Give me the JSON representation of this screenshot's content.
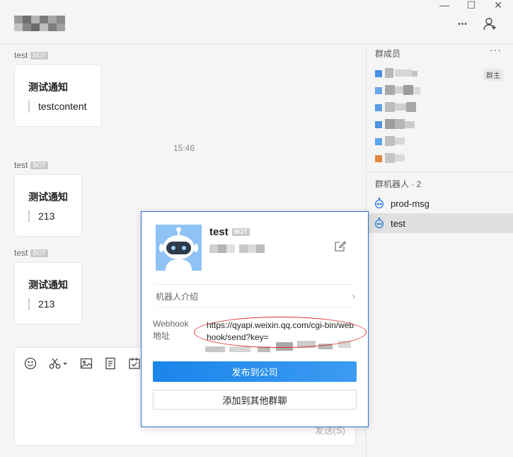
{
  "window": {
    "minimize_glyph": "—",
    "maximize_glyph": "☐",
    "close_glyph": "✕",
    "more_glyph": "•••",
    "add_member_icon": "add-user-icon"
  },
  "messages": [
    {
      "sender": "test",
      "badge": "BOT",
      "title": "测试通知",
      "content": "testcontent"
    },
    {
      "sender": "test",
      "badge": "BOT",
      "title": "测试通知",
      "content": "213"
    },
    {
      "sender": "test",
      "badge": "BOT",
      "title": "测试通知",
      "content": "213"
    }
  ],
  "timestamp": "15:46",
  "composer": {
    "tools": [
      "emoji-icon",
      "scissors-icon",
      "image-icon",
      "document-icon",
      "checklist-icon"
    ],
    "send_label": "发送(S)"
  },
  "side": {
    "members_header": "群成员",
    "more": "···",
    "owner_tag": "群主",
    "robots_header": "群机器人 · 2",
    "robots": [
      {
        "name": "prod-msg",
        "active": false
      },
      {
        "name": "test",
        "active": true
      }
    ]
  },
  "popup": {
    "name": "test",
    "badge": "BOT",
    "intro_label": "机器人介绍",
    "intro_chevron": "›",
    "webhook_label": "Webhook 地址",
    "webhook_url": "https://qyapi.weixin.qq.com/cgi-bin/webhook/send?key=",
    "publish_button": "发布到公司",
    "add_group_button": "添加到其他群聊"
  },
  "colors": {
    "accent": "#1a85ea",
    "highlight_ellipse": "#d33333",
    "avatar_bg": "#8fc2f5"
  }
}
